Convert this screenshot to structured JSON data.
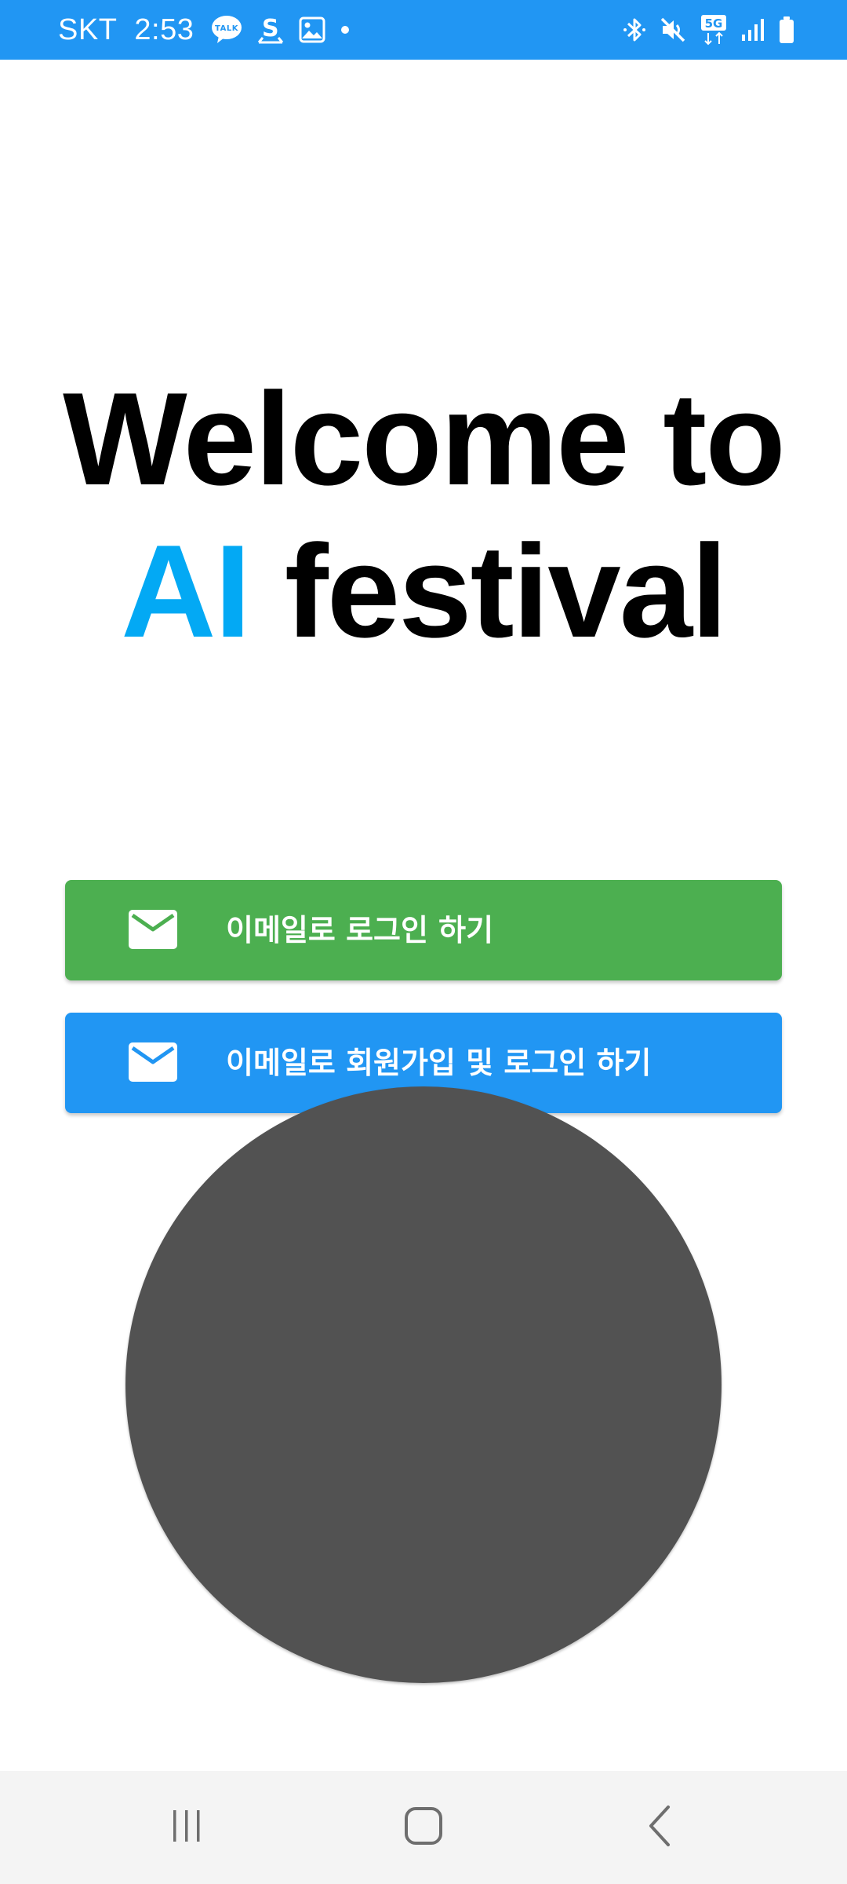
{
  "status_bar": {
    "carrier": "SKT",
    "time": "2:53",
    "left_icons": [
      "kakaotalk-icon",
      "s-icon",
      "gallery-icon",
      "dot-icon"
    ],
    "right_icons": [
      "bluetooth-icon",
      "mute-icon",
      "5g-icon",
      "signal-icon",
      "battery-icon"
    ],
    "network_label": "5G",
    "kakao_label": "TALK",
    "background_color": "#2196F3"
  },
  "title": {
    "line1": "Welcome to",
    "line2_accent": "AI",
    "line2_rest": " festival",
    "accent_color": "#03A9F4"
  },
  "buttons": {
    "email_login": {
      "label": "이메일로 로그인 하기",
      "icon": "mail-icon",
      "color": "#4CAF50"
    },
    "email_signup": {
      "label": "이메일로 회원가입 및 로그인 하기",
      "icon": "mail-icon",
      "color": "#2196F3"
    }
  },
  "circle": {
    "color": "#525252"
  },
  "nav_bar": {
    "items": [
      "recent-apps-icon",
      "home-icon",
      "back-icon"
    ]
  }
}
